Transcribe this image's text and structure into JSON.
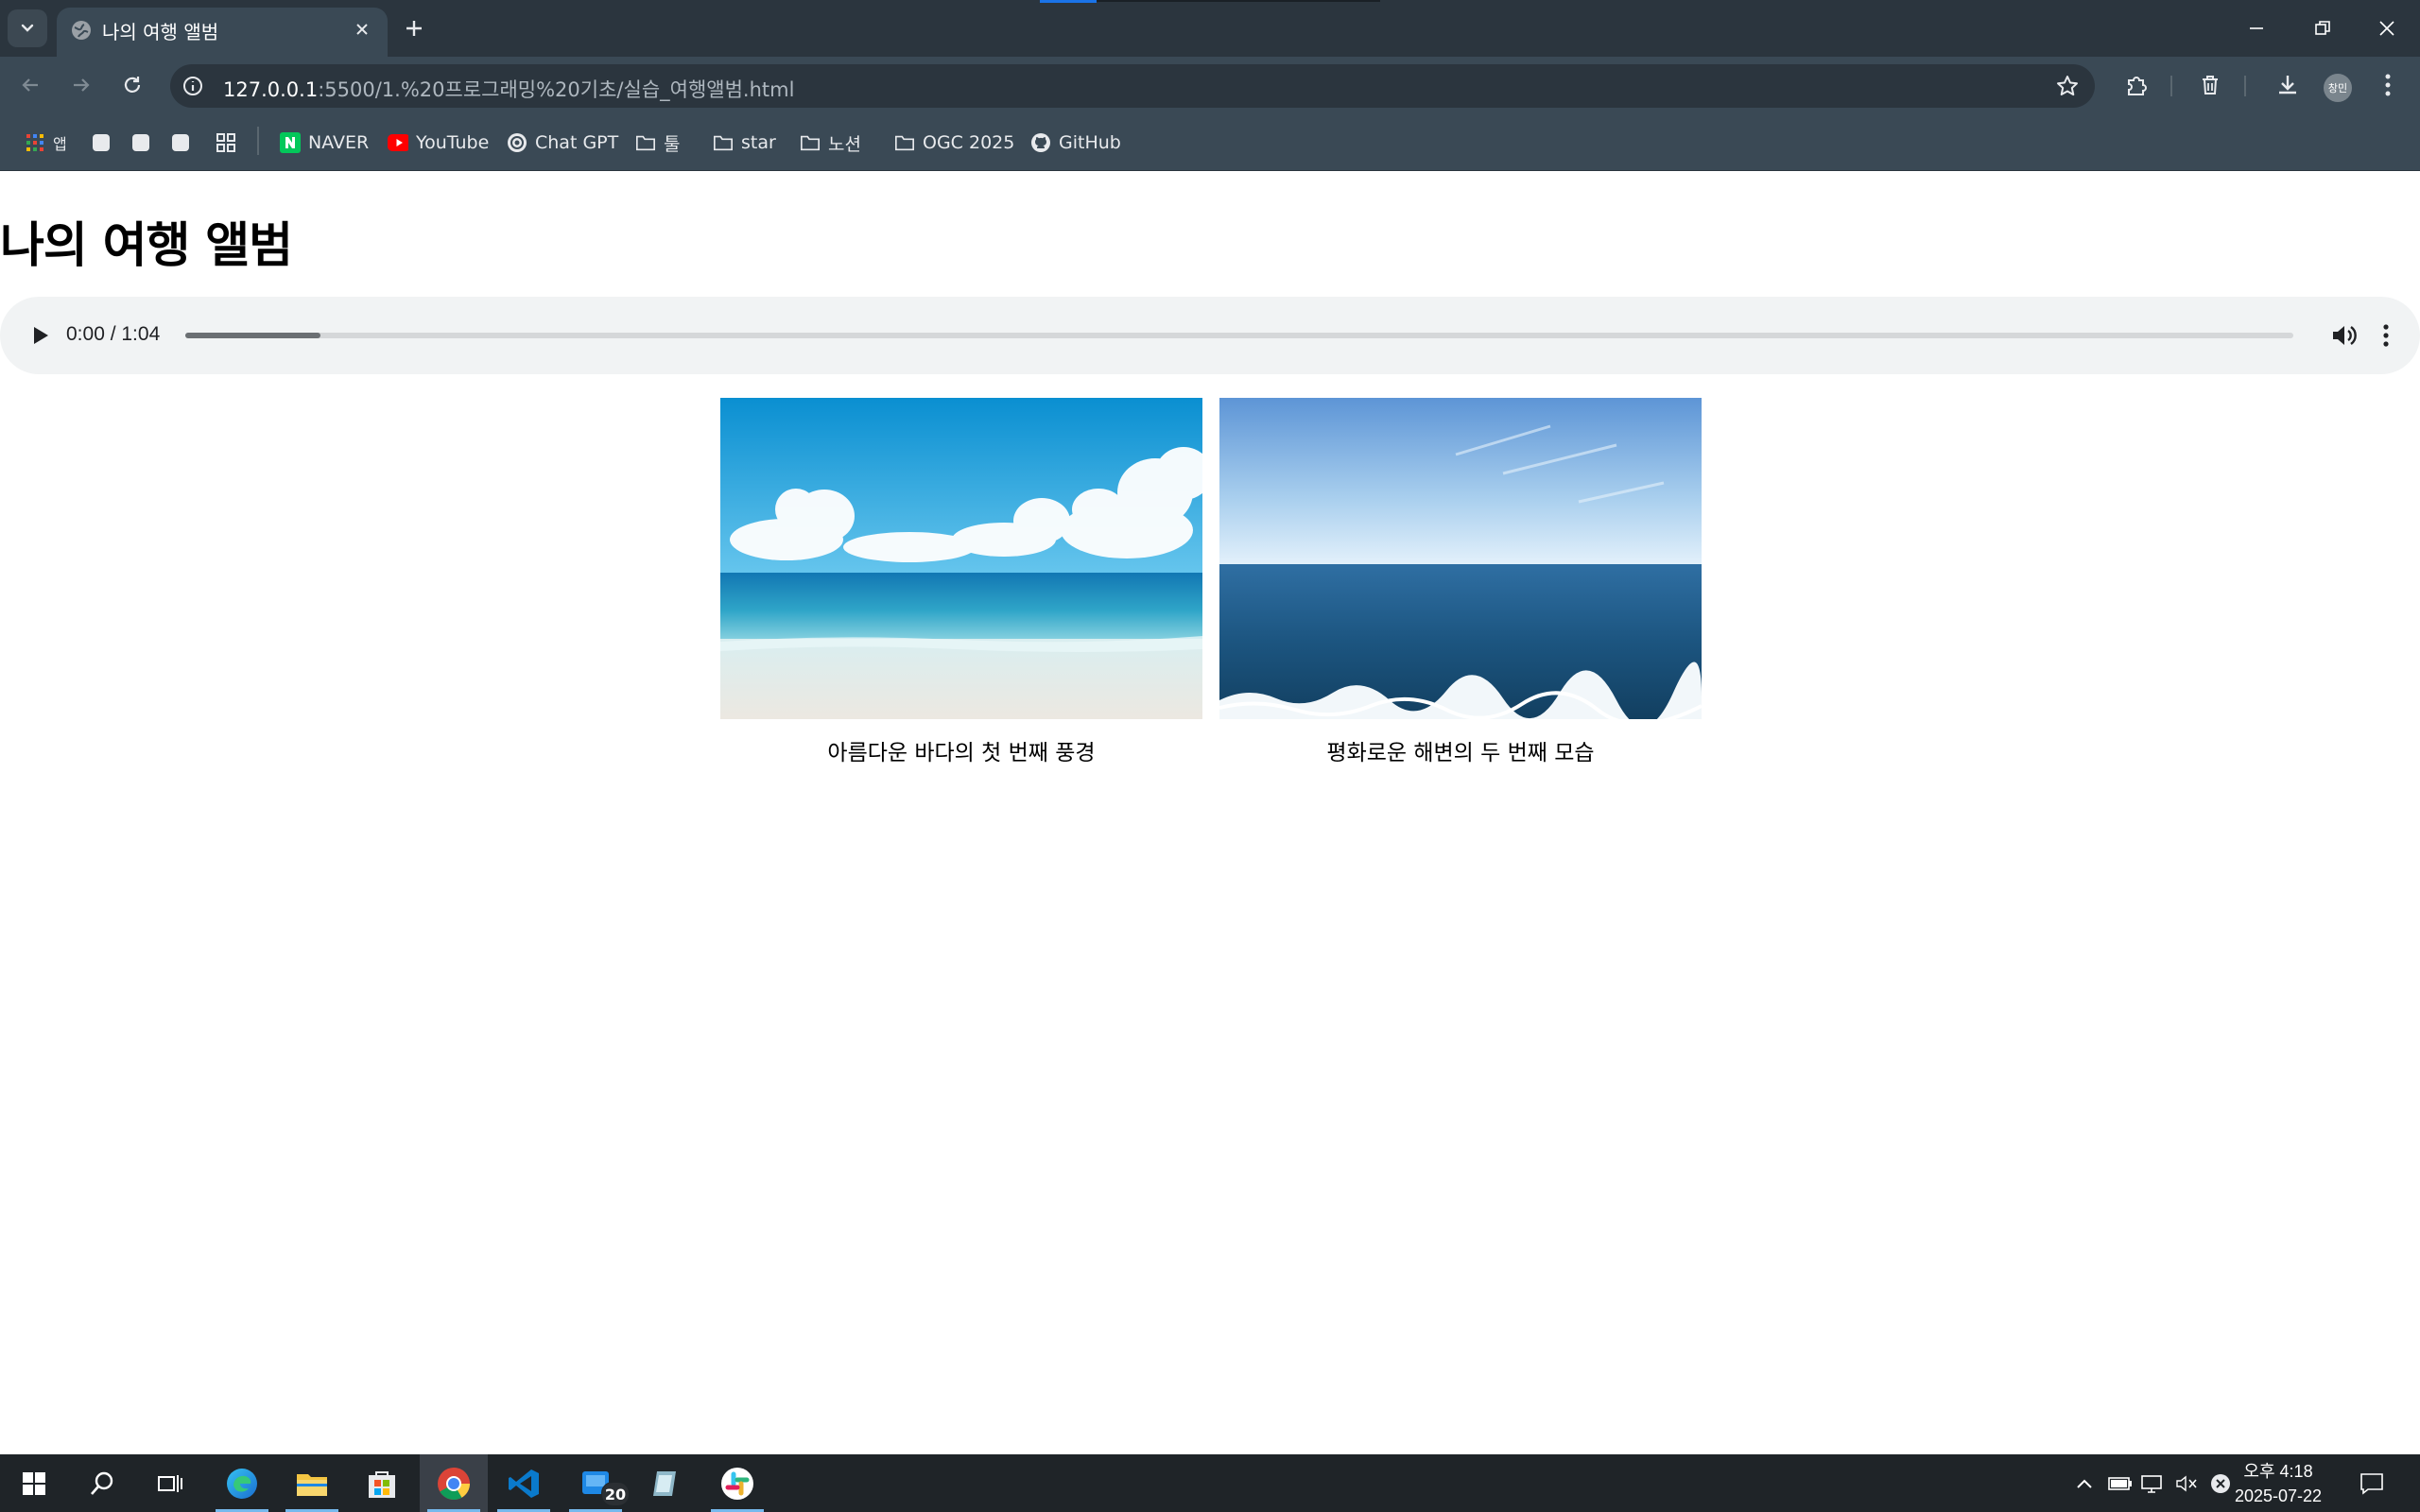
{
  "browser": {
    "tab": {
      "title": "나의 여행 앨범"
    },
    "address": {
      "host": "127.0.0.1",
      "path": ":5500/1.%20프로그래밍%20기초/실습_여행앨범.html"
    },
    "profile_initials": "창민"
  },
  "bookmarks": [
    {
      "label": "앱",
      "icon": "apps-grid-icon"
    },
    {
      "label": "",
      "icon": "favicon-blank"
    },
    {
      "label": "",
      "icon": "favicon-blank"
    },
    {
      "label": "",
      "icon": "favicon-blank"
    },
    {
      "label": "",
      "icon": "grid-icon"
    },
    {
      "label": "NAVER",
      "icon": "naver-icon"
    },
    {
      "label": "YouTube",
      "icon": "youtube-icon"
    },
    {
      "label": "Chat GPT",
      "icon": "openai-icon"
    },
    {
      "label": "툴",
      "icon": "folder-icon"
    },
    {
      "label": "star",
      "icon": "folder-icon"
    },
    {
      "label": "노션",
      "icon": "folder-icon"
    },
    {
      "label": "OGC 2025",
      "icon": "folder-icon"
    },
    {
      "label": "GitHub",
      "icon": "github-icon"
    }
  ],
  "page": {
    "title": "나의 여행 앨범",
    "audio": {
      "time": "0:00 / 1:04",
      "buffered_fraction": 0.064
    },
    "photos": [
      {
        "caption": "아름다운 바다의 첫 번째 풍경",
        "image": "tropical-beach-photo"
      },
      {
        "caption": "평화로운 해변의 두 번째 모습",
        "image": "open-sea-photo"
      }
    ]
  },
  "taskbar": {
    "apps": [
      "start-icon",
      "search-icon",
      "task-view-icon",
      "edge-icon",
      "file-explorer-icon",
      "store-icon",
      "chrome-icon",
      "vscode-icon",
      "app-icon",
      "notes-icon",
      "slack-icon"
    ],
    "badge_count": "20",
    "clock": {
      "time": "오후 4:18",
      "date": "2025-07-22"
    }
  },
  "colors": {
    "tab_strip": "#2b353e",
    "toolbar": "#3a4955",
    "audio_bg": "#f1f3f4",
    "taskbar": "#1f2428"
  }
}
